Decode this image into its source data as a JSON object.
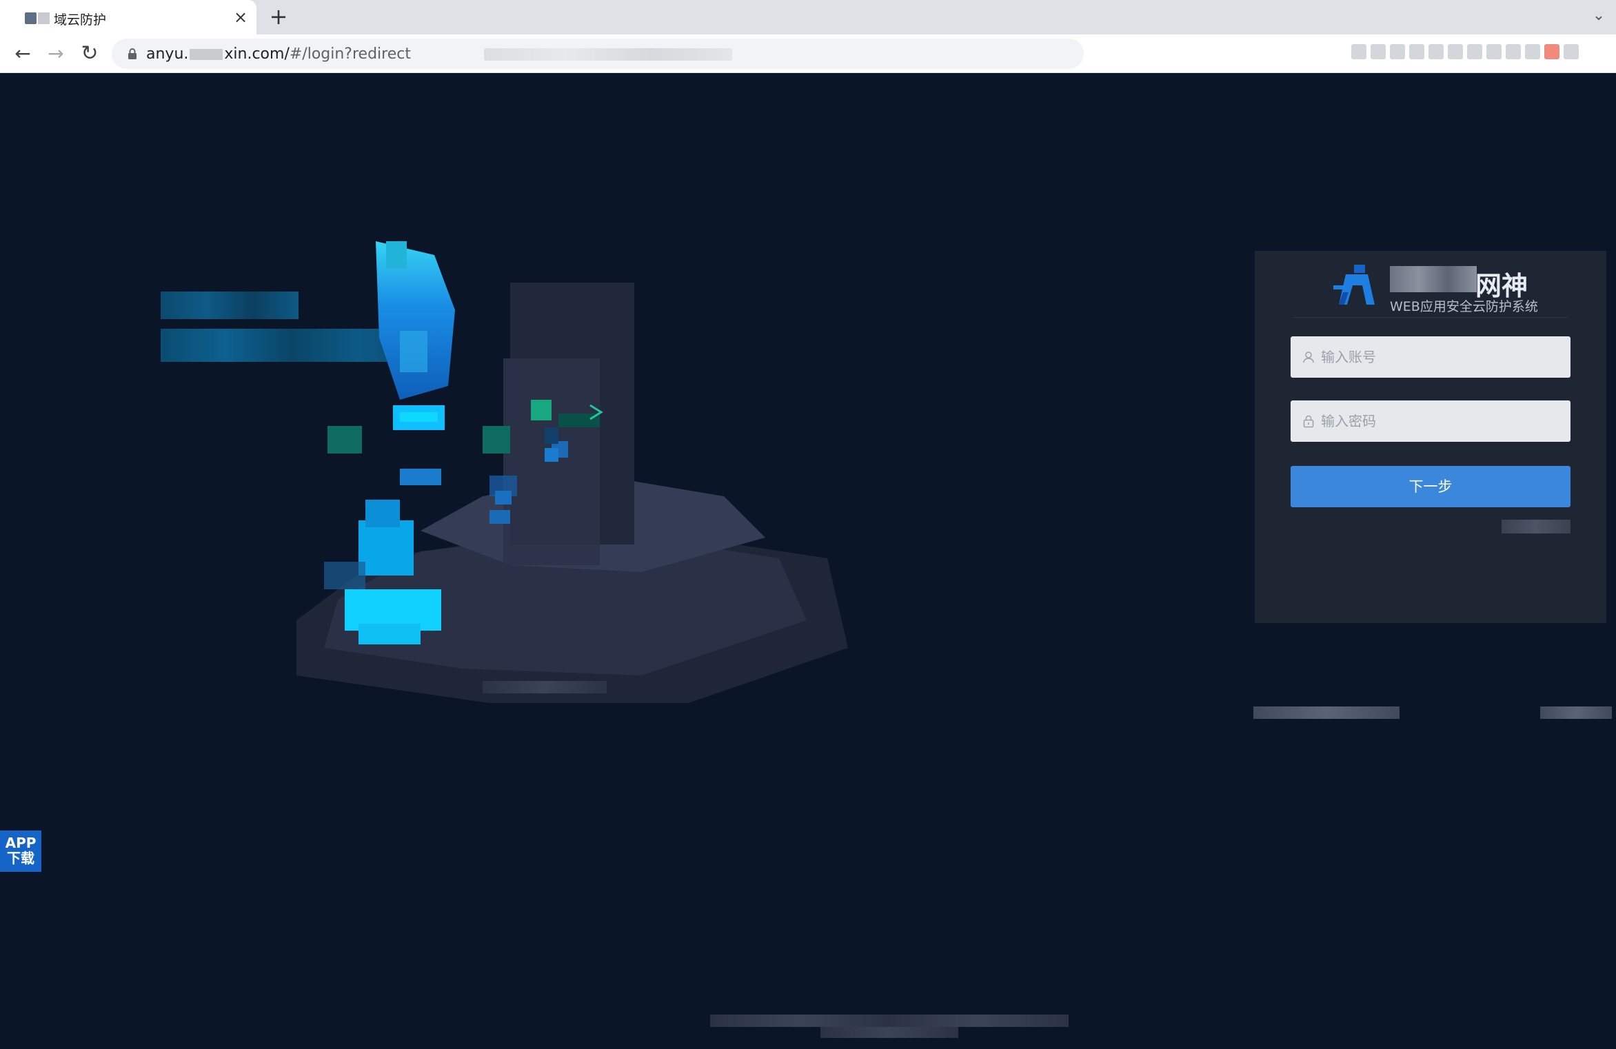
{
  "browser": {
    "tab": {
      "title": "域云防护",
      "close_glyph": "×"
    },
    "new_tab_glyph": "+",
    "dropdown_glyph": "⌄",
    "nav": {
      "back_glyph": "←",
      "forward_glyph": "→",
      "reload_glyph": "↻"
    },
    "url": {
      "host_start": "anyu.",
      "host_end": "xin.com/",
      "path": "#/login?redirect"
    }
  },
  "login": {
    "brand": "网神",
    "subtitle": "WEB应用安全云防护系统",
    "account_placeholder": "输入账号",
    "password_placeholder": "输入密码",
    "next_label": "下一步"
  },
  "app_download": {
    "line1": "APP",
    "line2": "下载"
  },
  "colors": {
    "background": "#0a1628",
    "card": "#1e2633",
    "primary": "#3a87dc",
    "app_badge": "#1565c8"
  },
  "icons": {
    "favicon": "site-favicon",
    "lock": "lock-icon",
    "user": "user-icon",
    "password": "padlock-icon",
    "logo": "shield-logo-icon"
  }
}
